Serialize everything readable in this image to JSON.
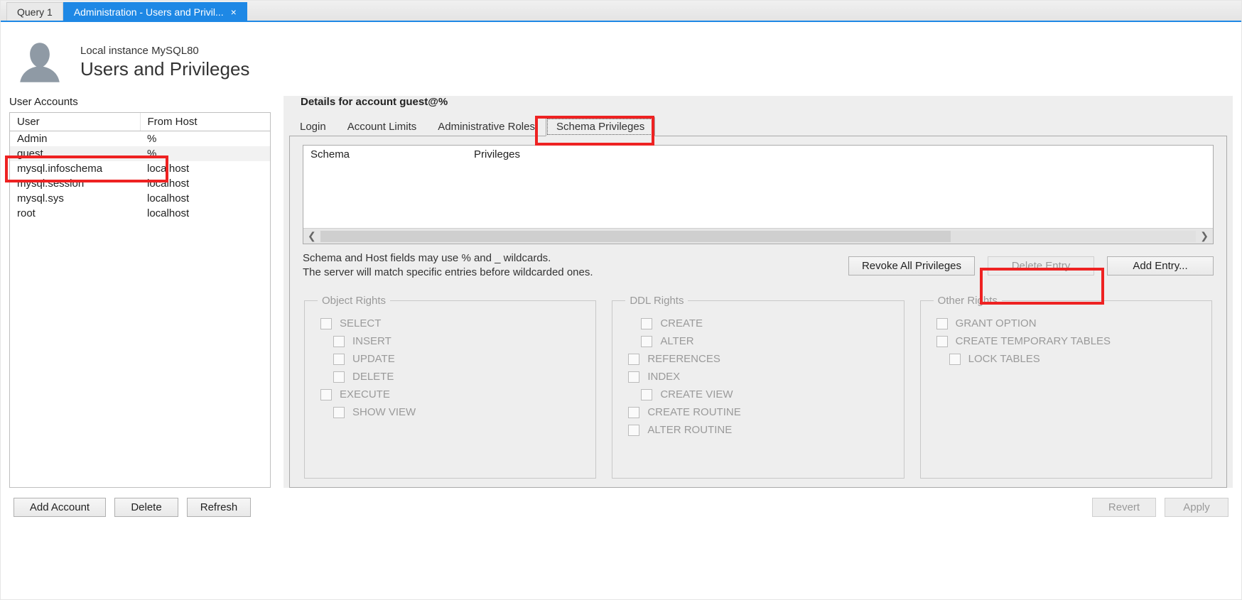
{
  "tabs": {
    "inactive": "Query 1",
    "active": "Administration - Users and Privil..."
  },
  "header": {
    "instance": "Local instance MySQL80",
    "title": "Users and Privileges"
  },
  "left": {
    "label": "User Accounts",
    "col_user": "User",
    "col_host": "From Host",
    "rows": [
      {
        "user": "Admin",
        "host": "%"
      },
      {
        "user": "guest",
        "host": "%"
      },
      {
        "user": "mysql.infoschema",
        "host": "localhost"
      },
      {
        "user": "mysql.session",
        "host": "localhost"
      },
      {
        "user": "mysql.sys",
        "host": "localhost"
      },
      {
        "user": "root",
        "host": "localhost"
      }
    ]
  },
  "details": {
    "label": "Details for account guest@%",
    "tabs": [
      "Login",
      "Account Limits",
      "Administrative Roles",
      "Schema Privileges"
    ],
    "schema_col": "Schema",
    "priv_col": "Privileges",
    "help_line1": "Schema and Host fields may use % and _ wildcards.",
    "help_line2": "The server will match specific entries before wildcarded ones.",
    "btn_revoke": "Revoke All Privileges",
    "btn_delete": "Delete Entry",
    "btn_add": "Add Entry..."
  },
  "rights": {
    "object": {
      "legend": "Object Rights",
      "items": [
        "SELECT",
        "INSERT",
        "UPDATE",
        "DELETE",
        "EXECUTE",
        "SHOW VIEW"
      ],
      "indent": [
        1,
        2,
        3,
        5
      ]
    },
    "ddl": {
      "legend": "DDL Rights",
      "items": [
        "CREATE",
        "ALTER",
        "REFERENCES",
        "INDEX",
        "CREATE VIEW",
        "CREATE ROUTINE",
        "ALTER ROUTINE"
      ],
      "indent": [
        0,
        1,
        4
      ]
    },
    "other": {
      "legend": "Other Rights",
      "items": [
        "GRANT OPTION",
        "CREATE TEMPORARY TABLES",
        "LOCK TABLES"
      ],
      "indent": [
        2
      ]
    }
  },
  "bottom": {
    "add": "Add Account",
    "del": "Delete",
    "refresh": "Refresh",
    "revert": "Revert",
    "apply": "Apply"
  }
}
